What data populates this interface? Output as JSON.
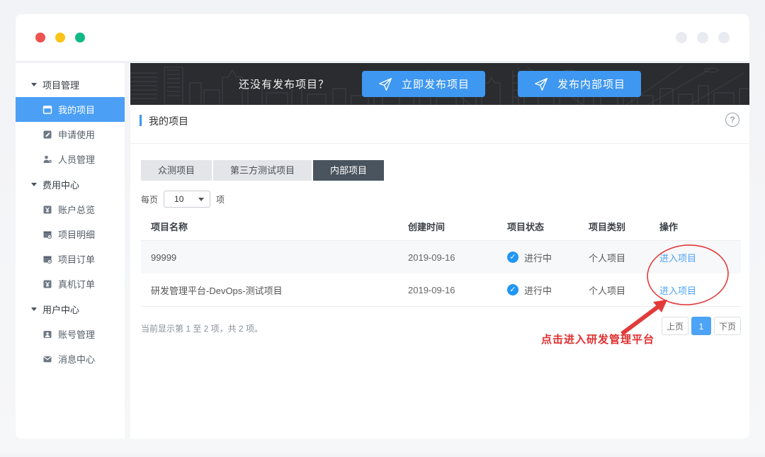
{
  "window": {
    "traffic_lights": {
      "red": "#ef5350",
      "yellow": "#fcc419",
      "green": "#12b886"
    }
  },
  "sidebar": {
    "groups": [
      {
        "label": "项目管理",
        "items": [
          {
            "label": "我的项目",
            "icon": "my-projects-icon",
            "active": true
          },
          {
            "label": "申请使用",
            "icon": "apply-use-icon",
            "active": false
          },
          {
            "label": "人员管理",
            "icon": "people-manage-icon",
            "active": false
          }
        ]
      },
      {
        "label": "费用中心",
        "items": [
          {
            "label": "账户总览",
            "icon": "account-overview-icon",
            "active": false
          },
          {
            "label": "项目明细",
            "icon": "project-detail-icon",
            "active": false
          },
          {
            "label": "项目订单",
            "icon": "project-order-icon",
            "active": false
          },
          {
            "label": "真机订单",
            "icon": "device-order-icon",
            "active": false
          }
        ]
      },
      {
        "label": "用户中心",
        "items": [
          {
            "label": "账号管理",
            "icon": "account-manage-icon",
            "active": false
          },
          {
            "label": "消息中心",
            "icon": "message-center-icon",
            "active": false
          }
        ]
      }
    ]
  },
  "banner": {
    "prompt": "还没有发布项目？",
    "publish_now_label": "立即发布项目",
    "publish_internal_label": "发布内部项目",
    "button_icon": "paper-plane-icon"
  },
  "section": {
    "title": "我的项目",
    "help_icon": "question-circle-icon",
    "help_glyph": "?"
  },
  "tabs": [
    {
      "label": "众测项目",
      "active": false
    },
    {
      "label": "第三方测试项目",
      "active": false
    },
    {
      "label": "内部项目",
      "active": true
    }
  ],
  "per_page": {
    "prefix": "每页",
    "selected": "10",
    "suffix": "项"
  },
  "table": {
    "columns": {
      "name": "项目名称",
      "created": "创建时间",
      "status": "项目状态",
      "category": "项目类别",
      "action": "操作"
    },
    "rows": [
      {
        "name": "99999",
        "created": "2019-09-16",
        "status": "进行中",
        "status_icon": "check-circle-icon",
        "category": "个人项目",
        "action": "进入项目"
      },
      {
        "name": "研发管理平台-DevOps-测试项目",
        "created": "2019-09-16",
        "status": "进行中",
        "status_icon": "check-circle-icon",
        "category": "个人项目",
        "action": "进入项目"
      }
    ],
    "summary": "当前显示第 1 至 2 项，共 2 项。"
  },
  "pagination": {
    "prev": "上页",
    "current": "1",
    "next": "下页"
  },
  "annotation": {
    "text": "点击进入研发管理平台"
  },
  "status_glyph": "✓",
  "colors": {
    "accent_blue": "#3e97f0",
    "sidebar_active_bg": "#4b9ff5",
    "link_blue": "#4da3f5",
    "status_blue": "#2196f3",
    "tab_active_bg": "#49545e",
    "annotation_red": "#e02f2f",
    "banner_bg": "#2a2c2f"
  }
}
